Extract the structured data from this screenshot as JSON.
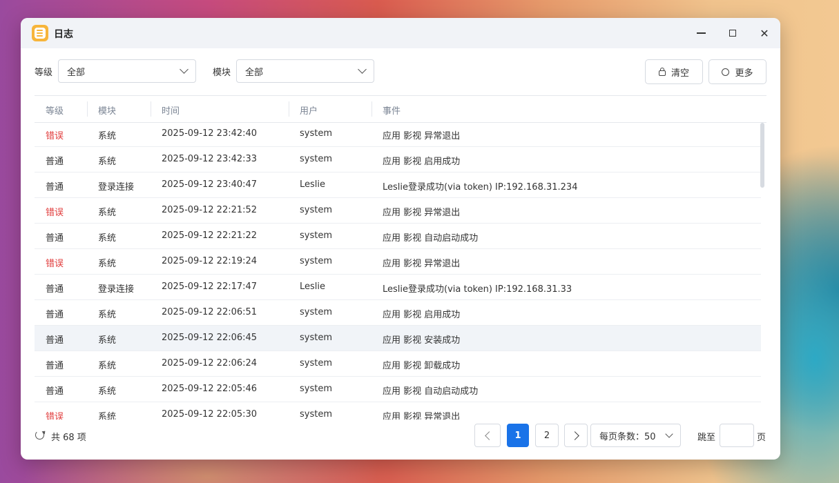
{
  "window": {
    "title": "日志"
  },
  "filters": {
    "level_label": "等级",
    "level_value": "全部",
    "module_label": "模块",
    "module_value": "全部"
  },
  "toolbar": {
    "clear_label": "清空",
    "more_label": "更多"
  },
  "table": {
    "columns": [
      "等级",
      "模块",
      "时间",
      "用户",
      "事件"
    ],
    "rows": [
      {
        "level": "错误",
        "module": "系统",
        "time": "2025-09-12 23:42:40",
        "user": "system",
        "event": "应用 影视 异常退出"
      },
      {
        "level": "普通",
        "module": "系统",
        "time": "2025-09-12 23:42:33",
        "user": "system",
        "event": "应用 影视 启用成功"
      },
      {
        "level": "普通",
        "module": "登录连接",
        "time": "2025-09-12 23:40:47",
        "user": "Leslie",
        "event": "Leslie登录成功(via token) IP:192.168.31.234"
      },
      {
        "level": "错误",
        "module": "系统",
        "time": "2025-09-12 22:21:52",
        "user": "system",
        "event": "应用 影视 异常退出"
      },
      {
        "level": "普通",
        "module": "系统",
        "time": "2025-09-12 22:21:22",
        "user": "system",
        "event": "应用 影视 自动启动成功"
      },
      {
        "level": "错误",
        "module": "系统",
        "time": "2025-09-12 22:19:24",
        "user": "system",
        "event": "应用 影视 异常退出"
      },
      {
        "level": "普通",
        "module": "登录连接",
        "time": "2025-09-12 22:17:47",
        "user": "Leslie",
        "event": "Leslie登录成功(via token) IP:192.168.31.33"
      },
      {
        "level": "普通",
        "module": "系统",
        "time": "2025-09-12 22:06:51",
        "user": "system",
        "event": "应用 影视 启用成功"
      },
      {
        "level": "普通",
        "module": "系统",
        "time": "2025-09-12 22:06:45",
        "user": "system",
        "event": "应用 影视 安装成功"
      },
      {
        "level": "普通",
        "module": "系统",
        "time": "2025-09-12 22:06:24",
        "user": "system",
        "event": "应用 影视 卸载成功"
      },
      {
        "level": "普通",
        "module": "系统",
        "time": "2025-09-12 22:05:46",
        "user": "system",
        "event": "应用 影视 自动启动成功"
      },
      {
        "level": "错误",
        "module": "系统",
        "time": "2025-09-12 22:05:30",
        "user": "system",
        "event": "应用 影视 异常退出"
      }
    ]
  },
  "footer": {
    "total_text": "共 68 项",
    "pages": [
      "1",
      "2"
    ],
    "current_page": "1",
    "per_page_text": "每页条数：50",
    "jump_label": "跳至",
    "page_suffix": "页"
  },
  "colors": {
    "accent": "#1a73e8",
    "error": "#e03a3a"
  },
  "icons": [
    "app-log-icon",
    "minimize-icon",
    "maximize-icon",
    "close-icon",
    "chevron-down-icon",
    "lock-icon",
    "circle-icon",
    "refresh-icon",
    "chevron-left-icon",
    "chevron-right-icon"
  ]
}
